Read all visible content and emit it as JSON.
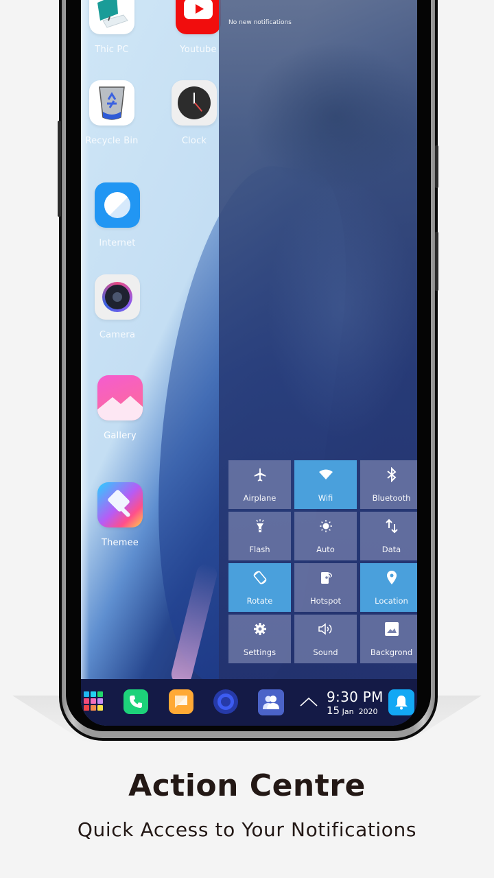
{
  "desktop": {
    "apps": [
      {
        "id": "this-pc",
        "label": "Thic PC"
      },
      {
        "id": "youtube",
        "label": "Youtube"
      },
      {
        "id": "recycle-bin",
        "label": "Recycle Bin"
      },
      {
        "id": "clock",
        "label": "Clock"
      },
      {
        "id": "internet",
        "label": "Internet"
      },
      {
        "id": "camera",
        "label": "Camera"
      },
      {
        "id": "gallery",
        "label": "Gallery"
      },
      {
        "id": "themee",
        "label": "Themee"
      }
    ]
  },
  "action_centre": {
    "notification_text": "No new notifications",
    "tiles": [
      {
        "label": "Airplane",
        "icon": "airplane-icon",
        "active": false
      },
      {
        "label": "Wifi",
        "icon": "wifi-icon",
        "active": true
      },
      {
        "label": "Bluetooth",
        "icon": "bluetooth-icon",
        "active": false
      },
      {
        "label": "Flash",
        "icon": "flashlight-icon",
        "active": false
      },
      {
        "label": "Auto",
        "icon": "brightness-icon",
        "active": false
      },
      {
        "label": "Data",
        "icon": "data-arrows-icon",
        "active": false
      },
      {
        "label": "Rotate",
        "icon": "rotate-icon",
        "active": true
      },
      {
        "label": "Hotspot",
        "icon": "hotspot-icon",
        "active": false
      },
      {
        "label": "Location",
        "icon": "location-pin-icon",
        "active": true
      },
      {
        "label": "Settings",
        "icon": "gear-icon",
        "active": false
      },
      {
        "label": "Sound",
        "icon": "speaker-icon",
        "active": false
      },
      {
        "label": "Backgrond",
        "icon": "image-icon",
        "active": false
      }
    ],
    "active_color": "#4aa0dc"
  },
  "taskbar": {
    "items": [
      "start-grid",
      "phone",
      "messages",
      "cortana",
      "contacts"
    ],
    "time": "9:30 PM",
    "date_day": "15",
    "date_month": "Jan",
    "date_year": "2020"
  },
  "promo": {
    "title": "Action Centre",
    "subtitle": "Quick Access to Your Notifications"
  }
}
